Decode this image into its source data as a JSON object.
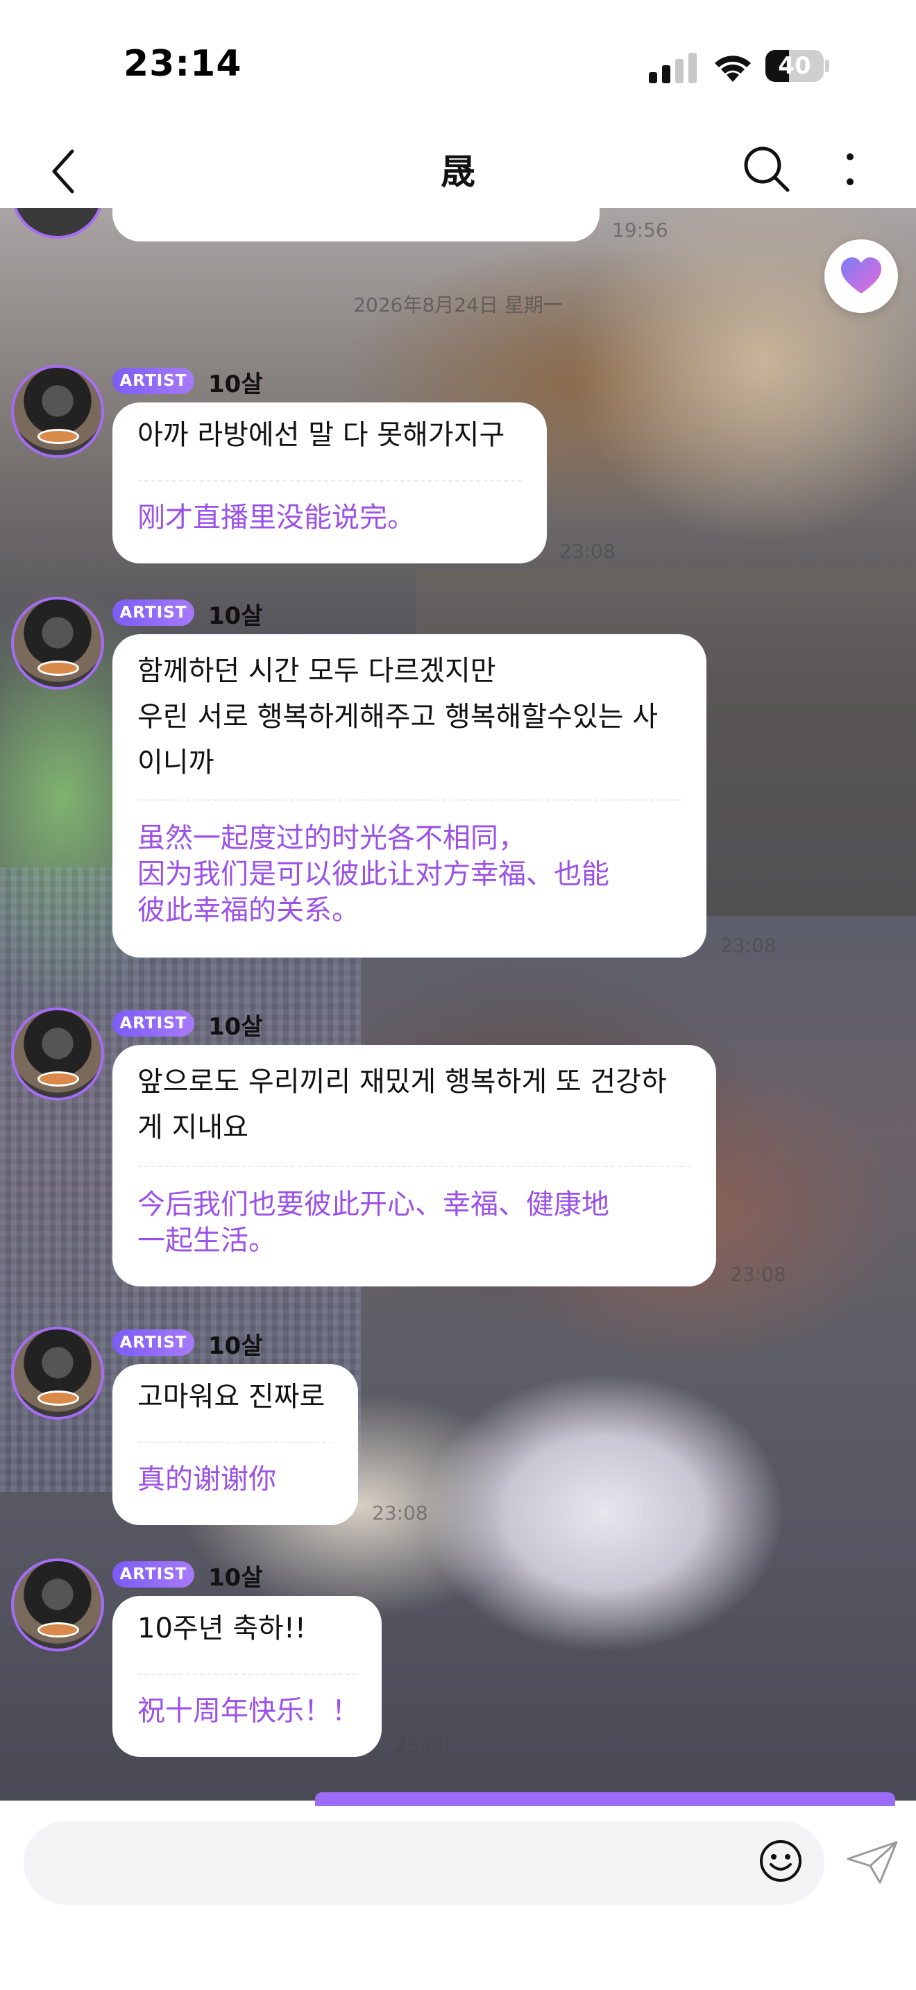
{
  "status_bar": {
    "time": "23:14",
    "battery": "40",
    "battery_level": 0.4
  },
  "nav": {
    "title": "晟"
  },
  "chat": {
    "top_partial_time": "19:56",
    "date_divider": "2026年8月24日 星期一",
    "messages": [
      {
        "badge": "ARTIST",
        "sender": "10살",
        "ko_lines": [
          "아까 라방에선 말 다 못해가지구"
        ],
        "zh_lines": [
          "刚才直播里没能说完。"
        ],
        "time": "23:08"
      },
      {
        "badge": "ARTIST",
        "sender": "10살",
        "ko_lines": [
          "함께하던 시간 모두 다르겠지만",
          "우린 서로 행복하게해주고 행복해할수있는 사",
          "이니까"
        ],
        "zh_lines": [
          "虽然一起度过的时光各不相同，",
          "因为我们是可以彼此让对方幸福、也能",
          "彼此幸福的关系。"
        ],
        "time": "23:08"
      },
      {
        "badge": "ARTIST",
        "sender": "10살",
        "ko_lines": [
          "앞으로도 우리끼리 재밌게 행복하게 또 건강하",
          "게 지내요"
        ],
        "zh_lines": [
          "今后我们也要彼此开心、幸福、健康地",
          "一起生活。"
        ],
        "time": "23:08"
      },
      {
        "badge": "ARTIST",
        "sender": "10살",
        "ko_lines": [
          "고마워요 진짜로"
        ],
        "zh_lines": [
          "真的谢谢你"
        ],
        "time": "23:08"
      },
      {
        "badge": "ARTIST",
        "sender": "10살",
        "ko_lines": [
          "10주년 축하!!"
        ],
        "zh_lines": [
          "祝十周年快乐！！"
        ],
        "time": "23:08"
      }
    ]
  },
  "input": {
    "placeholder": ""
  },
  "icons": {
    "back": "chevron-left-icon",
    "search": "search-icon",
    "more": "more-vertical-icon",
    "heart": "heart-icon",
    "emoji": "smiley-icon",
    "send": "send-icon"
  },
  "colors": {
    "accent": "#9b51e8",
    "badge_start": "#7b5cf6",
    "badge_end": "#a77af9"
  }
}
